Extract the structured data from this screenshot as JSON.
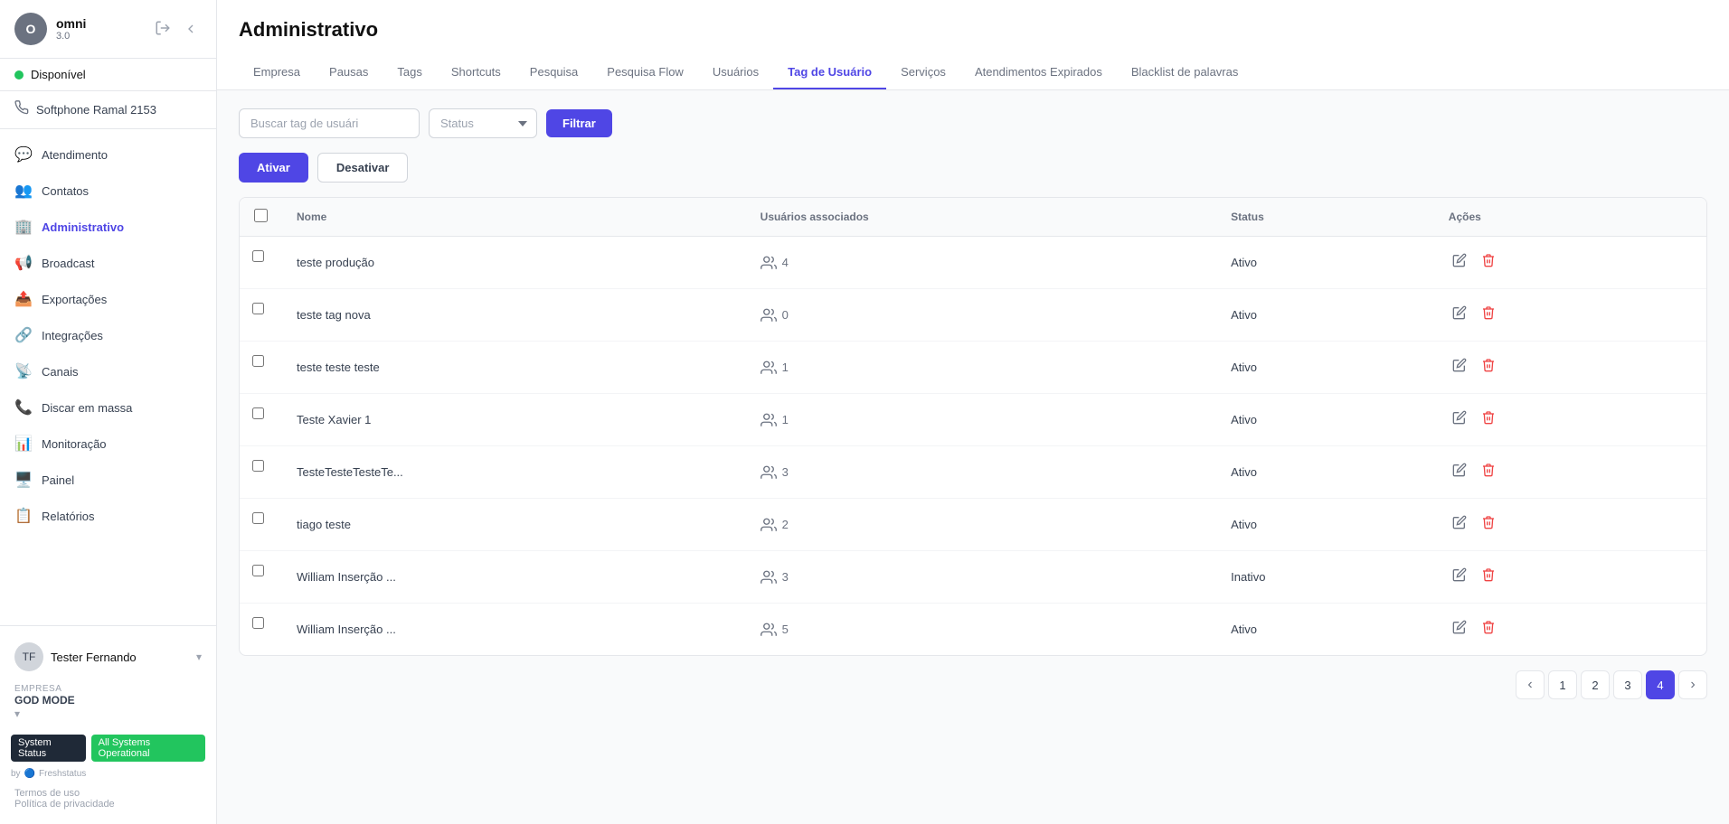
{
  "sidebar": {
    "app_name": "omni",
    "app_version": "3.0",
    "status_label": "Disponível",
    "softphone_label": "Softphone Ramal 2153",
    "nav_items": [
      {
        "id": "atendimento",
        "label": "Atendimento",
        "icon": "💬"
      },
      {
        "id": "contatos",
        "label": "Contatos",
        "icon": "👥"
      },
      {
        "id": "administrativo",
        "label": "Administrativo",
        "icon": "🏢",
        "active": true
      },
      {
        "id": "broadcast",
        "label": "Broadcast",
        "icon": "📢"
      },
      {
        "id": "exportacoes",
        "label": "Exportações",
        "icon": "📤"
      },
      {
        "id": "integracoes",
        "label": "Integrações",
        "icon": "🔗"
      },
      {
        "id": "canais",
        "label": "Canais",
        "icon": "📡"
      },
      {
        "id": "discar-em-massa",
        "label": "Discar em massa",
        "icon": "📞"
      },
      {
        "id": "monitoracao",
        "label": "Monitoração",
        "icon": "📊"
      },
      {
        "id": "painel",
        "label": "Painel",
        "icon": "🖥️"
      },
      {
        "id": "relatorios",
        "label": "Relatórios",
        "icon": "📋"
      }
    ],
    "user_name": "Tester Fernando",
    "empresa_label": "EMPRESA",
    "empresa_name": "GOD MODE",
    "system_status_label": "System Status",
    "system_status_value": "All Systems Operational",
    "by_label": "by",
    "freshstatus_label": "Freshstatus",
    "termos_label": "Termos de uso",
    "politica_label": "Política de privacidade"
  },
  "header": {
    "title": "Administrativo",
    "tabs": [
      {
        "id": "empresa",
        "label": "Empresa"
      },
      {
        "id": "pausas",
        "label": "Pausas"
      },
      {
        "id": "tags",
        "label": "Tags"
      },
      {
        "id": "shortcuts",
        "label": "Shortcuts"
      },
      {
        "id": "pesquisa",
        "label": "Pesquisa"
      },
      {
        "id": "pesquisa-flow",
        "label": "Pesquisa Flow"
      },
      {
        "id": "usuarios",
        "label": "Usuários"
      },
      {
        "id": "tag-de-usuario",
        "label": "Tag de Usuário",
        "active": true
      },
      {
        "id": "servicos",
        "label": "Serviços"
      },
      {
        "id": "atendimentos-expirados",
        "label": "Atendimentos Expirados"
      },
      {
        "id": "blacklist",
        "label": "Blacklist de palavras"
      }
    ]
  },
  "filters": {
    "search_placeholder": "Buscar tag de usuári",
    "status_placeholder": "Status",
    "filter_button": "Filtrar"
  },
  "actions": {
    "ativar_label": "Ativar",
    "desativar_label": "Desativar"
  },
  "table": {
    "columns": [
      "",
      "Nome",
      "Usuários associados",
      "Status",
      "Ações"
    ],
    "rows": [
      {
        "id": 1,
        "nome": "teste produção",
        "usuarios": 4,
        "status": "Ativo"
      },
      {
        "id": 2,
        "nome": "teste tag nova",
        "usuarios": 0,
        "status": "Ativo"
      },
      {
        "id": 3,
        "nome": "teste teste teste",
        "usuarios": 1,
        "status": "Ativo"
      },
      {
        "id": 4,
        "nome": "Teste Xavier 1",
        "usuarios": 1,
        "status": "Ativo"
      },
      {
        "id": 5,
        "nome": "TesteTesteTesteTe...",
        "usuarios": 3,
        "status": "Ativo"
      },
      {
        "id": 6,
        "nome": "tiago teste",
        "usuarios": 2,
        "status": "Ativo"
      },
      {
        "id": 7,
        "nome": "William Inserção ...",
        "usuarios": 3,
        "status": "Inativo"
      },
      {
        "id": 8,
        "nome": "William Inserção ...",
        "usuarios": 5,
        "status": "Ativo"
      }
    ]
  },
  "pagination": {
    "pages": [
      1,
      2,
      3,
      4
    ],
    "current": 4
  }
}
